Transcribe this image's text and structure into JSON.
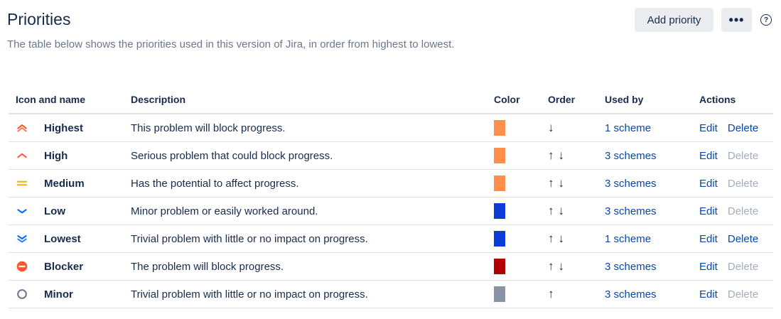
{
  "header": {
    "title": "Priorities",
    "subtitle": "The table below shows the priorities used in this version of Jira, in order from highest to lowest.",
    "add_button": "Add priority",
    "more_button": "•••",
    "help": "?"
  },
  "table": {
    "columns": [
      "Icon and name",
      "Description",
      "Color",
      "Order",
      "Used by",
      "Actions"
    ],
    "rows": [
      {
        "icon": "priority-highest-icon",
        "name": "Highest",
        "description": "This problem will block progress.",
        "color": "#ff8f4c",
        "order_up": "",
        "order_down": "↓",
        "used_by": "1 scheme",
        "edit": "Edit",
        "delete": "Delete",
        "delete_enabled": true
      },
      {
        "icon": "priority-high-icon",
        "name": "High",
        "description": "Serious problem that could block progress.",
        "color": "#ff8f4c",
        "order_up": "↑",
        "order_down": "↓",
        "used_by": "3 schemes",
        "edit": "Edit",
        "delete": "Delete",
        "delete_enabled": false
      },
      {
        "icon": "priority-medium-icon",
        "name": "Medium",
        "description": "Has the potential to affect progress.",
        "color": "#ff8f4c",
        "order_up": "↑",
        "order_down": "↓",
        "used_by": "3 schemes",
        "edit": "Edit",
        "delete": "Delete",
        "delete_enabled": false
      },
      {
        "icon": "priority-low-icon",
        "name": "Low",
        "description": "Minor problem or easily worked around.",
        "color": "#0c3cd6",
        "order_up": "↑",
        "order_down": "↓",
        "used_by": "3 schemes",
        "edit": "Edit",
        "delete": "Delete",
        "delete_enabled": false
      },
      {
        "icon": "priority-lowest-icon",
        "name": "Lowest",
        "description": "Trivial problem with little or no impact on progress.",
        "color": "#0c3cd6",
        "order_up": "↑",
        "order_down": "↓",
        "used_by": "1 scheme",
        "edit": "Edit",
        "delete": "Delete",
        "delete_enabled": true
      },
      {
        "icon": "priority-blocker-icon",
        "name": "Blocker",
        "description": "The problem will block progress.",
        "color": "#b00000",
        "order_up": "↑",
        "order_down": "↓",
        "used_by": "3 schemes",
        "edit": "Edit",
        "delete": "Delete",
        "delete_enabled": false
      },
      {
        "icon": "priority-minor-icon",
        "name": "Minor",
        "description": "Trivial problem with little or no impact on progress.",
        "color": "#8993a4",
        "order_up": "↑",
        "order_down": "",
        "used_by": "3 schemes",
        "edit": "Edit",
        "delete": "Delete",
        "delete_enabled": false
      }
    ]
  }
}
